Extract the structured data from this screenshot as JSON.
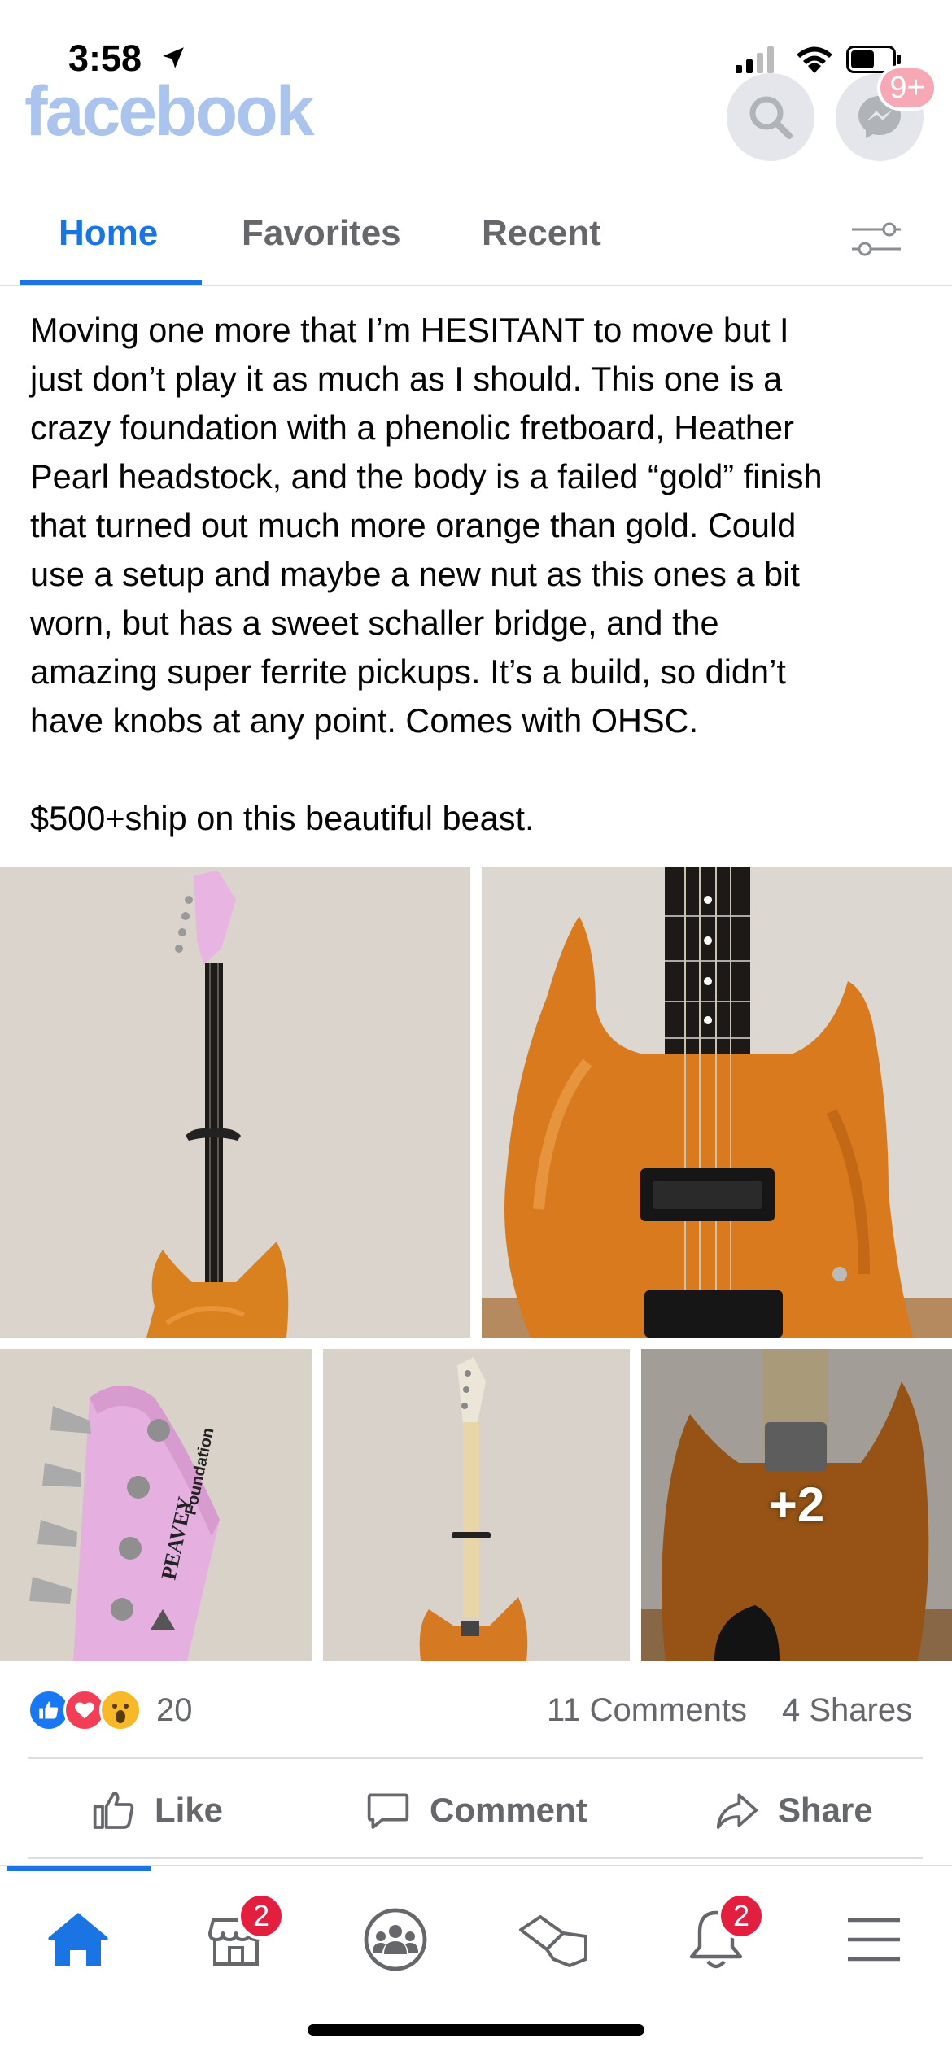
{
  "status_bar": {
    "time": "3:58"
  },
  "header": {
    "logo": "facebook",
    "messenger_badge": "9+",
    "icons": [
      "search-icon",
      "messenger-icon"
    ]
  },
  "tabs": [
    {
      "label": "Home",
      "active": true
    },
    {
      "label": "Favorites",
      "active": false
    },
    {
      "label": "Recent",
      "active": false
    }
  ],
  "post": {
    "text": "Moving one more that I’m HESITANT to move but I\njust don’t play it as much as I should. This one is a\ncrazy foundation with a phenolic fretboard, Heather\nPearl headstock, and the body is a failed “gold” finish\nthat turned out much more orange than gold. Could\nuse a setup and maybe a new nut as this ones a bit\nworn, but has a sweet schaller bridge, and the\namazing super ferrite pickups. It’s a build, so didn’t\nhave knobs at any point. Comes with OHSC.\n\n$500+ship on this beautiful beast.",
    "photos": [
      {
        "description": "Full bass guitar with pink headstock against wall"
      },
      {
        "description": "Orange bass body close-up with pickups"
      },
      {
        "description": "Pink Peavey Foundation headstock"
      },
      {
        "description": "Back of bass with maple neck"
      },
      {
        "description": "Back of orange bass body",
        "more_label": "+2"
      }
    ],
    "headstock_logo": "PEAVEY",
    "headstock_model": "Foundation",
    "reaction_count": "20",
    "comments": "11 Comments",
    "shares": "4 Shares"
  },
  "actions": {
    "like": "Like",
    "comment": "Comment",
    "share": "Share"
  },
  "bottom_nav": {
    "marketplace_badge": "2",
    "notifications_badge": "2"
  },
  "colors": {
    "accent": "#1b74e4",
    "logo_faded": "#aac4ee",
    "badge": "#e41e3f",
    "guitar_orange": "#d97a1e"
  }
}
